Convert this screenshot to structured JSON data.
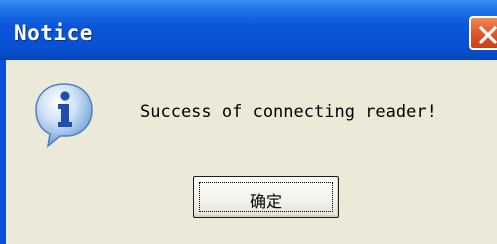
{
  "dialog": {
    "title": "Notice",
    "message": "Success of connecting reader!",
    "ok_label": "确定",
    "icons": {
      "info": "info-icon",
      "close": "close-icon"
    }
  },
  "colors": {
    "titlebar": "#0a55d8",
    "window_bg": "#ece9d8",
    "close_button": "#e25a2c"
  }
}
